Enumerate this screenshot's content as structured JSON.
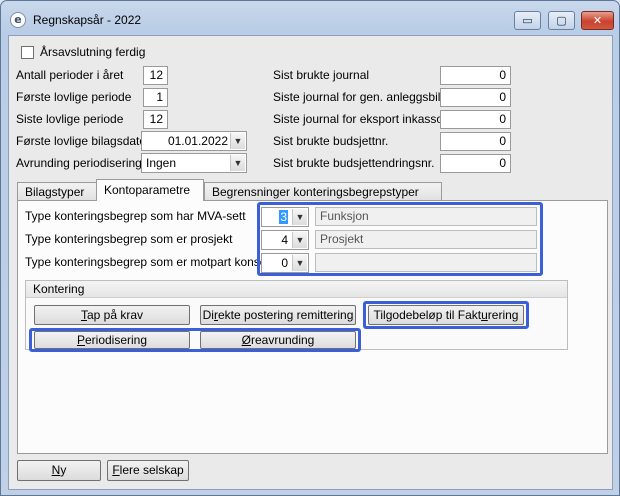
{
  "window": {
    "title": "Regnskapsår - 2022",
    "app_icon": "e",
    "controls": {
      "minimize": "▭",
      "maximize": "▢",
      "close": "✕"
    }
  },
  "header": {
    "checkbox_label": "Årsavslutning ferdig",
    "checkbox_checked": false,
    "left_fields": [
      {
        "label": "Antall perioder i året",
        "value": "12"
      },
      {
        "label": "Første lovlige periode",
        "value": "1"
      },
      {
        "label": "Siste lovlige periode",
        "value": "12"
      },
      {
        "label": "Første lovlige bilagsdato",
        "value": "01.01.2022"
      },
      {
        "label": "Avrunding periodisering",
        "value": "Ingen"
      }
    ],
    "right_fields": [
      {
        "label": "Sist brukte journal",
        "value": "0"
      },
      {
        "label": "Siste journal for gen. anleggsbilag",
        "value": "0"
      },
      {
        "label": "Siste journal for eksport inkasso",
        "value": "0"
      },
      {
        "label": "Sist brukte budsjettnr.",
        "value": "0"
      },
      {
        "label": "Sist brukte budsjettendringsnr.",
        "value": "0"
      }
    ]
  },
  "tabs": [
    {
      "label": "Bilagstyper"
    },
    {
      "label": "Kontoparametre"
    },
    {
      "label": "Begrensninger konteringsbegrepstyper"
    }
  ],
  "kontoparametre": {
    "rows": [
      {
        "label": "Type konteringsbegrep som har MVA-sett",
        "value": "3",
        "name": "Funksjon"
      },
      {
        "label": "Type konteringsbegrep som er prosjekt",
        "value": "4",
        "name": "Prosjekt"
      },
      {
        "label": "Type konteringsbegrep som er motpart konsern",
        "value": "0",
        "name": ""
      }
    ]
  },
  "kontering": {
    "title": "Kontering",
    "buttons": [
      {
        "pre": "",
        "key": "T",
        "post": "ap på krav"
      },
      {
        "pre": "Di",
        "key": "r",
        "post": "ekte postering remittering"
      },
      {
        "pre": "Tilgodebeløp til Fakt",
        "key": "u",
        "post": "rering"
      },
      {
        "pre": "",
        "key": "P",
        "post": "eriodisering"
      },
      {
        "pre": "",
        "key": "Ø",
        "post": "reavrunding"
      }
    ]
  },
  "footer": {
    "buttons": [
      {
        "pre": "",
        "key": "N",
        "post": "y"
      },
      {
        "pre": "",
        "key": "F",
        "post": "lere selskap"
      }
    ]
  },
  "colors": {
    "highlight": "#3a5fd6",
    "titlebar": "#c9d8ec",
    "close_button": "#c9432f"
  },
  "icons": {
    "combo_arrow": "chevron-down-icon",
    "app": "app-logo-icon"
  }
}
